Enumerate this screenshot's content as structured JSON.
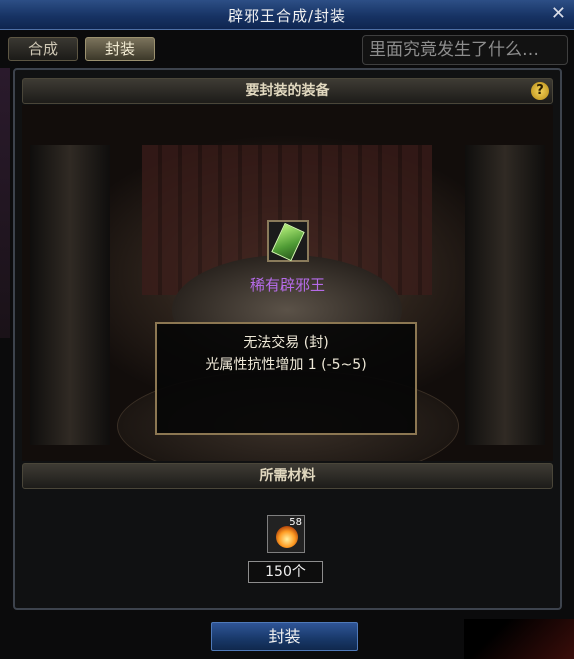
{
  "window": {
    "title": "辟邪王合成/封装",
    "close_icon": "close-icon"
  },
  "tabs": [
    {
      "label": "合成",
      "active": false
    },
    {
      "label": "封装",
      "active": true
    }
  ],
  "background_text": "里面究竟发生了什么…",
  "equipment_section": {
    "title": "要封装的装备",
    "help_icon": "question-mark-icon",
    "help_label": "?",
    "item": {
      "name": "稀有辟邪王",
      "icon": "talisman-icon",
      "name_color": "#b56be8"
    },
    "tooltip": {
      "line1": "无法交易 (封)",
      "line2": "光属性抗性增加 1 (-5~5)"
    }
  },
  "materials_section": {
    "title": "所需材料",
    "material": {
      "icon": "fire-ember-icon",
      "owned_count": "58"
    },
    "quantity": "150个"
  },
  "action_button": {
    "label": "封装"
  }
}
